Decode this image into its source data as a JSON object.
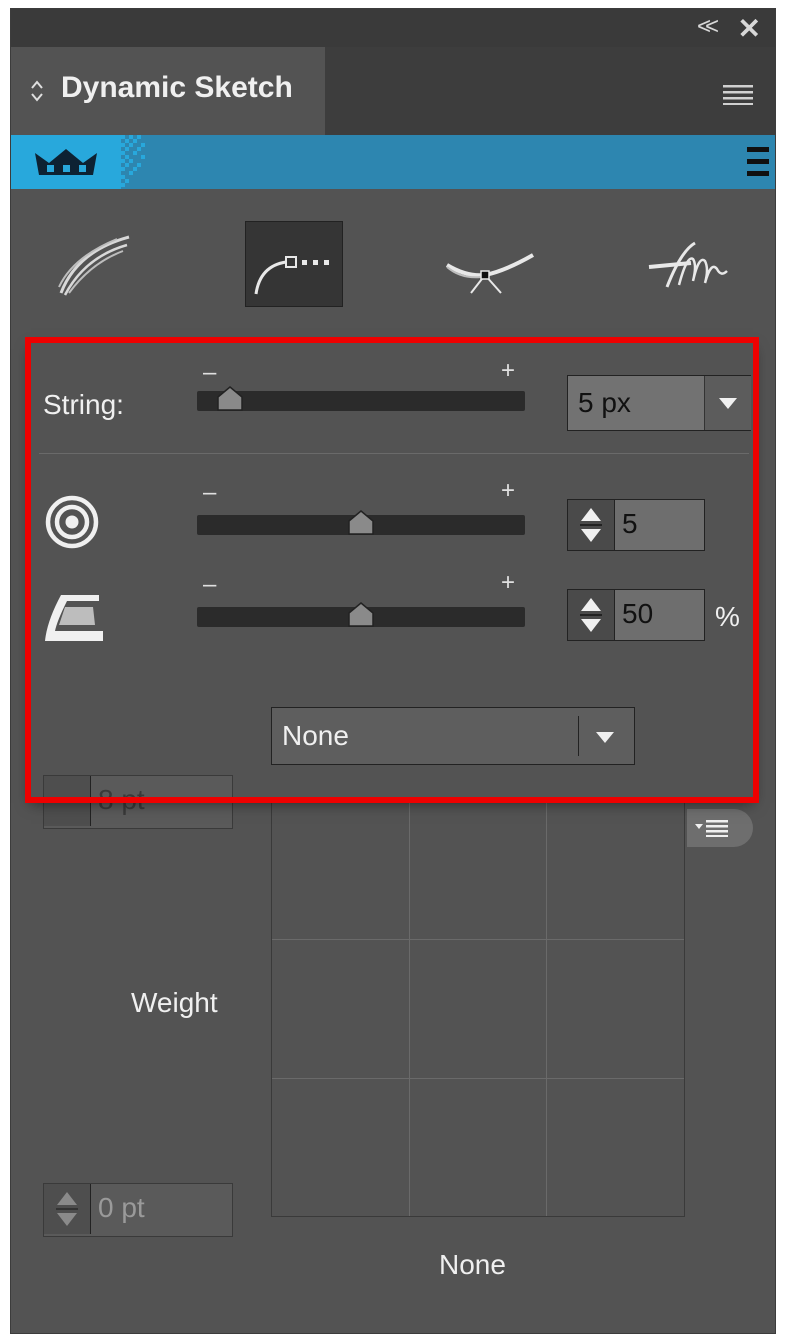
{
  "window": {
    "collapse_label": "<<",
    "close_label": "✕"
  },
  "tab": {
    "title": "Dynamic Sketch"
  },
  "tools": [
    {
      "name": "sketch-strokes"
    },
    {
      "name": "string-mode"
    },
    {
      "name": "join-mode"
    },
    {
      "name": "scribble-mode"
    }
  ],
  "controls": {
    "string": {
      "label": "String:",
      "slider_fraction": 0.1,
      "value": "5 px"
    },
    "rings": {
      "icon": "concentric-circles-icon",
      "slider_fraction": 0.5,
      "value": "5"
    },
    "smoothing": {
      "icon": "iron-icon",
      "slider_fraction": 0.5,
      "value": "50",
      "unit": "%"
    },
    "minus_symbol": "–",
    "plus_symbol": "+",
    "dropdown_value": "None"
  },
  "width_profile": {
    "max_value": "8 pt",
    "min_value": "0 pt",
    "axis_label": "Weight",
    "profile_label": "None"
  },
  "colors": {
    "panel_bg": "#535353",
    "accent_blue": "#2d86b0",
    "highlight_red": "#ee0000"
  }
}
